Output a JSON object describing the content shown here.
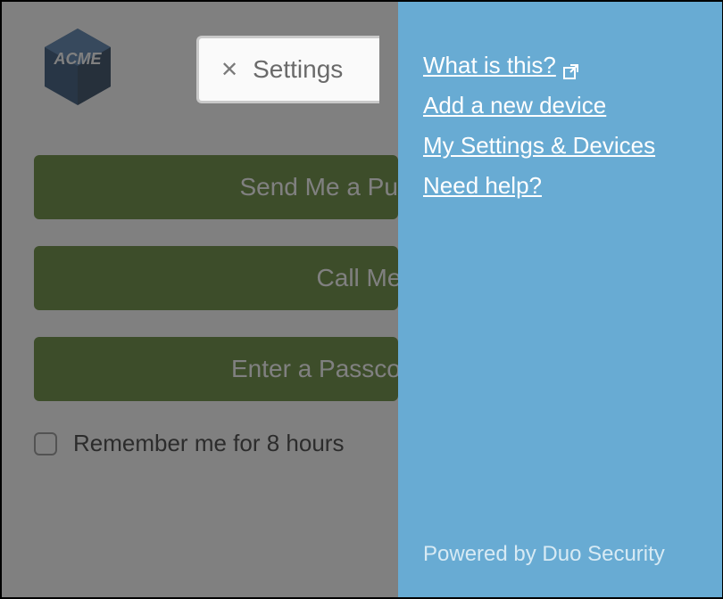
{
  "logo_text": "ACME",
  "settings": {
    "label": "Settings"
  },
  "buttons": {
    "push": "Send Me a Push",
    "call": "Call Me",
    "passcode": "Enter a Passcode"
  },
  "remember": {
    "label": "Remember me for 8 hours"
  },
  "sidebar": {
    "links": [
      "What is this?",
      "Add a new device",
      "My Settings & Devices",
      "Need help?"
    ],
    "footer": "Powered by Duo Security"
  },
  "colors": {
    "panel": "#68abd3",
    "button": "#507a1e"
  }
}
